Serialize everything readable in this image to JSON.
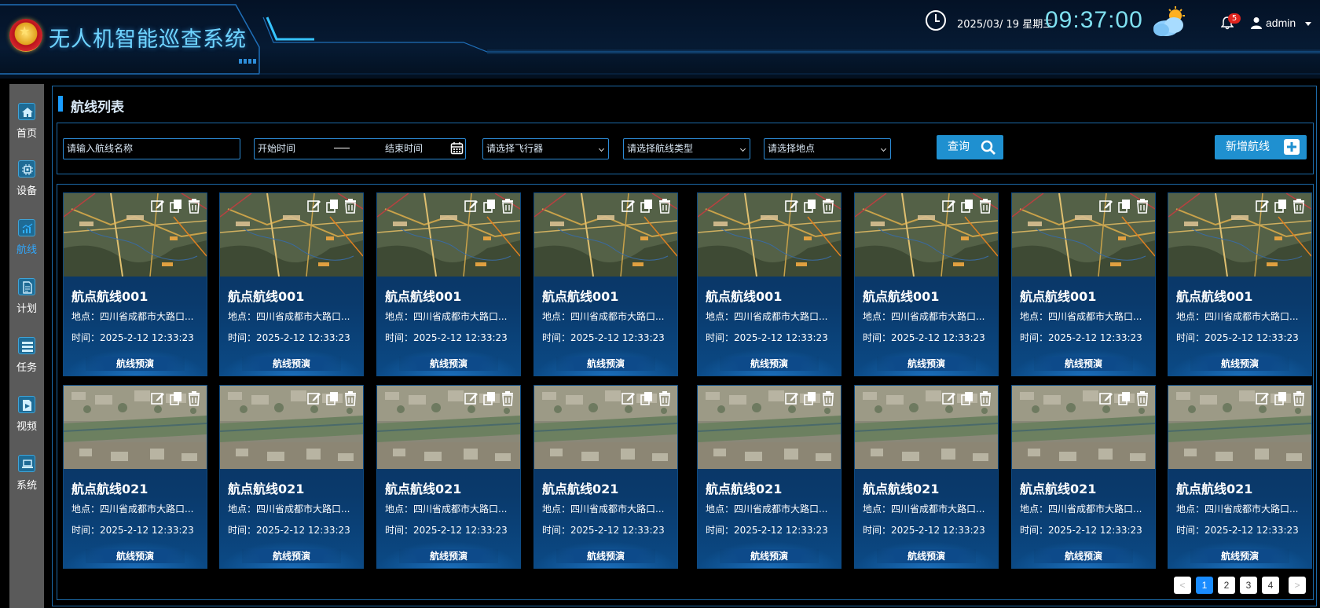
{
  "header": {
    "app_title": "无人机智能巡查系统",
    "date": "2025/03/ 19 星期三",
    "time": "09:37:00",
    "notification_count": "5",
    "user": "admin"
  },
  "sidebar": {
    "items": [
      {
        "label": "首页",
        "icon": "home-icon",
        "active": false
      },
      {
        "label": "设备",
        "icon": "chip-icon",
        "active": false
      },
      {
        "label": "航线",
        "icon": "route-chart-icon",
        "active": true
      },
      {
        "label": "计划",
        "icon": "document-icon",
        "active": false
      },
      {
        "label": "任务",
        "icon": "task-list-icon",
        "active": false
      },
      {
        "label": "视频",
        "icon": "video-icon",
        "active": false
      },
      {
        "label": "系统",
        "icon": "laptop-icon",
        "active": false
      }
    ]
  },
  "page": {
    "title": "航线列表"
  },
  "filters": {
    "route_name_placeholder": "请输入航线名称",
    "start_time_placeholder": "开始时间",
    "range_separator": "—",
    "end_time_placeholder": "结束时间",
    "aircraft_placeholder": "请选择飞行器",
    "route_type_placeholder": "请选择航线类型",
    "location_placeholder": "请选择地点",
    "query_label": "查询",
    "add_label": "新增航线"
  },
  "cards_row1": {
    "title": "航点航线001",
    "location": "地点：四川省成都市大路口...",
    "time": "时间：2025-2-12 12:33:23",
    "preview_label": "航线预演",
    "thumb": "city-map-satellite"
  },
  "cards_row2": {
    "title": "航点航线021",
    "location": "地点：四川省成都市大路口...",
    "time": "时间：2025-2-12 12:33:23",
    "preview_label": "航线预演",
    "thumb": "rural-satellite"
  },
  "pagination": {
    "pages": [
      "1",
      "2",
      "3",
      "4"
    ],
    "current": "1",
    "prev": "<",
    "next": ">"
  },
  "colors": {
    "accent": "#1a9dff",
    "title_cyan": "#6fd4ff",
    "time_cyan": "#7fe0f0",
    "card_bg": "#0a3a6c",
    "border": "#1c6aa8"
  }
}
